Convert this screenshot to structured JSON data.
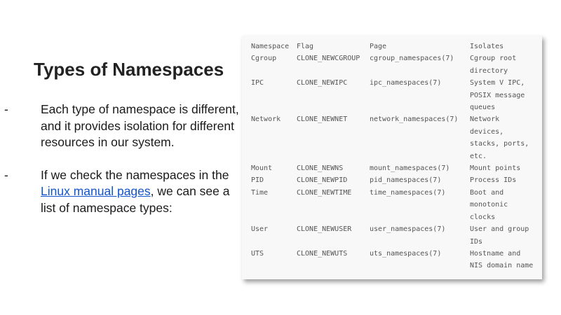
{
  "slide": {
    "title": "Types of Namespaces",
    "bullets": [
      {
        "marker": "-",
        "text": "Each type of namespace is different, and it provides isolation for different resources in our system."
      },
      {
        "marker": "-",
        "before": "If we check the namespaces in the ",
        "link": "Linux manual pages",
        "after": ", we can see a list of namespace types:"
      }
    ]
  },
  "namespace_table": {
    "headers": [
      "Namespace",
      "Flag",
      "Page",
      "Isolates"
    ],
    "rows": [
      [
        "Cgroup",
        "CLONE_NEWCGROUP",
        "cgroup_namespaces(7)",
        "Cgroup root directory"
      ],
      [
        "IPC",
        "CLONE_NEWIPC",
        "ipc_namespaces(7)",
        "System V IPC, POSIX message queues"
      ],
      [
        "Network",
        "CLONE_NEWNET",
        "network_namespaces(7)",
        "Network devices, stacks, ports, etc."
      ],
      [
        "Mount",
        "CLONE_NEWNS",
        "mount_namespaces(7)",
        "Mount points"
      ],
      [
        "PID",
        "CLONE_NEWPID",
        "pid_namespaces(7)",
        "Process IDs"
      ],
      [
        "Time",
        "CLONE_NEWTIME",
        "time_namespaces(7)",
        "Boot and monotonic clocks"
      ],
      [
        "User",
        "CLONE_NEWUSER",
        "user_namespaces(7)",
        "User and group IDs"
      ],
      [
        "UTS",
        "CLONE_NEWUTS",
        "uts_namespaces(7)",
        "Hostname and NIS domain name"
      ]
    ]
  },
  "colors": {
    "link": "#1155cc",
    "table_background": "#f8f8f8",
    "table_text": "#555555",
    "title": "#222222"
  }
}
